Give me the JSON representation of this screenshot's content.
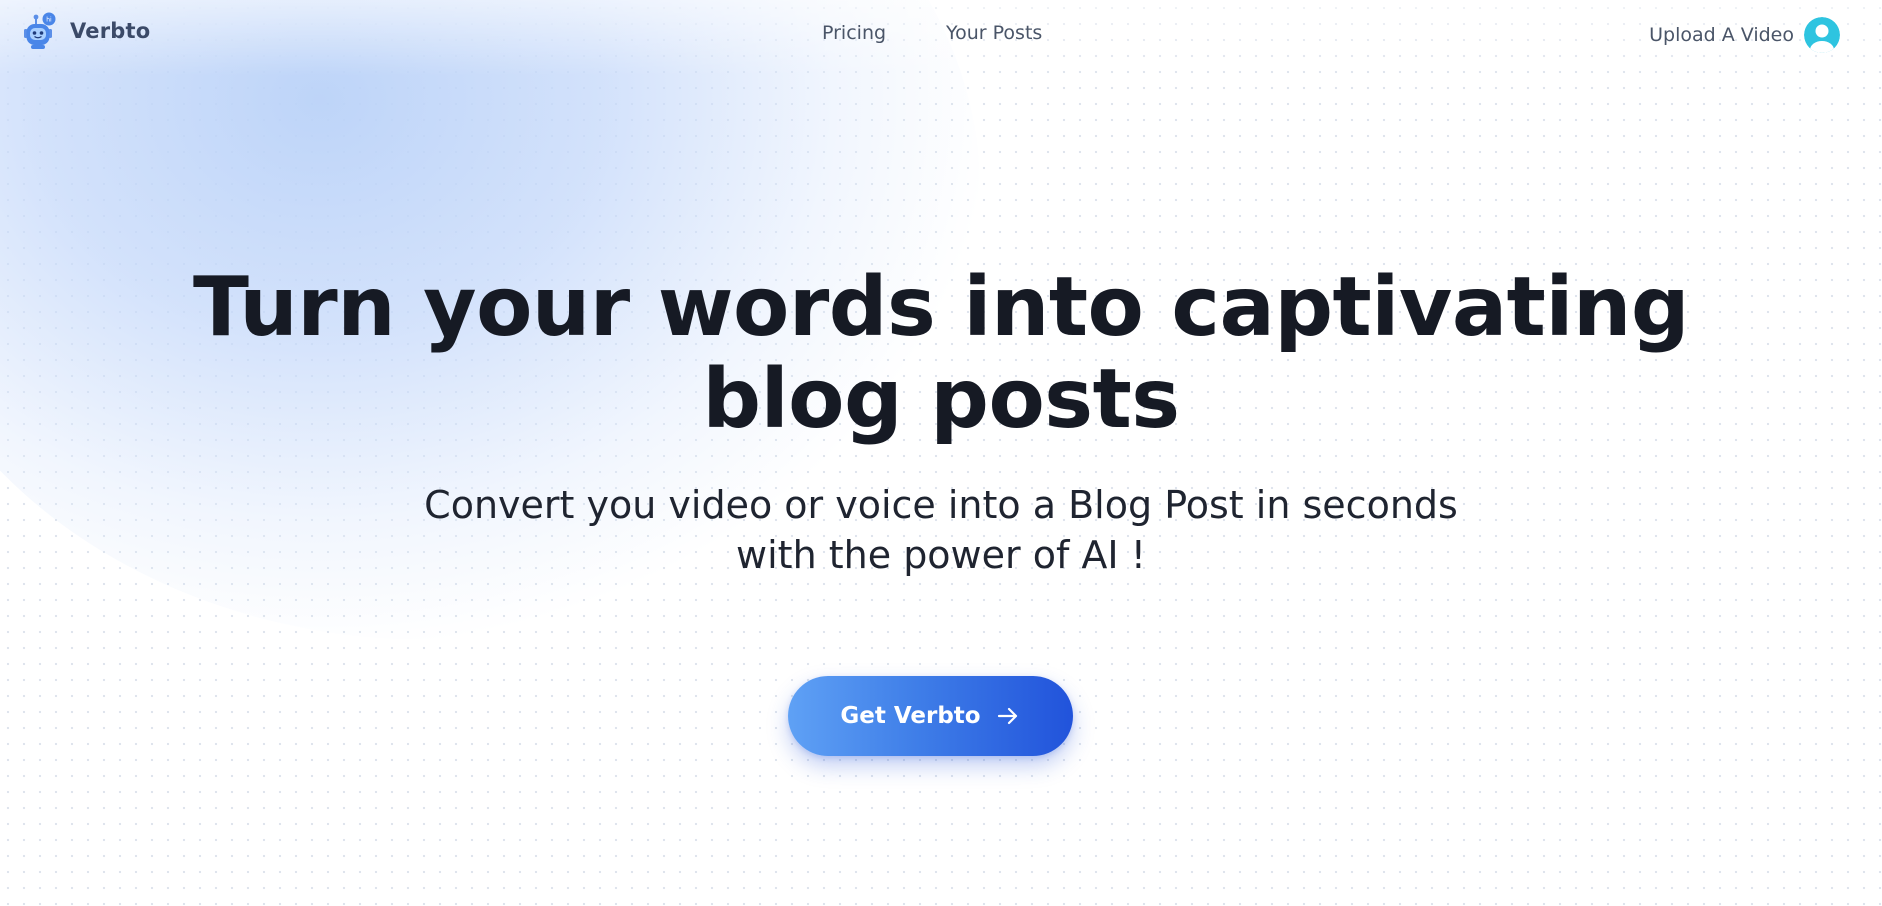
{
  "nav": {
    "brand_name": "Verbto",
    "links": [
      {
        "label": "Pricing"
      },
      {
        "label": "Your Posts"
      }
    ],
    "upload_label": "Upload A Video"
  },
  "hero": {
    "headline_line1_start": "Turn your words into ",
    "headline_accent": "captivating",
    "headline_line2": "blog posts",
    "subhead_line1": "Convert you video or voice into a Blog Post in seconds",
    "subhead_line2": "with the power of AI !"
  },
  "cta": {
    "label": "Get Verbto"
  },
  "icons": {
    "logo": "robot-logo-icon",
    "avatar": "user-avatar-icon",
    "cta_arrow": "arrow-right-icon"
  },
  "colors": {
    "brand_text": "#3b4a68",
    "headline": "#161a24",
    "cta_gradient_start": "#5fa1f5",
    "cta_gradient_end": "#2153db",
    "underline_accent": "#c2daf7",
    "avatar": "#2ec4e0"
  }
}
